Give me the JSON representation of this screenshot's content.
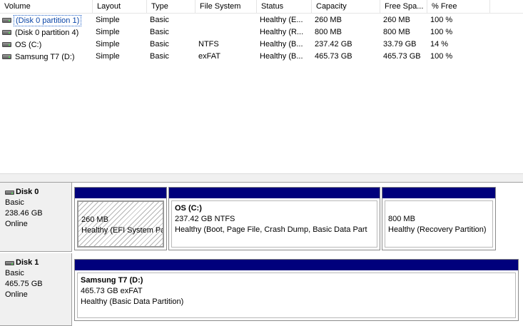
{
  "volume_list": {
    "columns": [
      "Volume",
      "Layout",
      "Type",
      "File System",
      "Status",
      "Capacity",
      "Free Spa...",
      "% Free"
    ],
    "rows": [
      {
        "volume": "(Disk 0 partition 1)",
        "layout": "Simple",
        "type": "Basic",
        "fs": "",
        "status": "Healthy (E...",
        "capacity": "260 MB",
        "free": "260 MB",
        "pct": "100 %",
        "selected": true
      },
      {
        "volume": "(Disk 0 partition 4)",
        "layout": "Simple",
        "type": "Basic",
        "fs": "",
        "status": "Healthy (R...",
        "capacity": "800 MB",
        "free": "800 MB",
        "pct": "100 %"
      },
      {
        "volume": "OS (C:)",
        "layout": "Simple",
        "type": "Basic",
        "fs": "NTFS",
        "status": "Healthy (B...",
        "capacity": "237.42 GB",
        "free": "33.79 GB",
        "pct": "14 %"
      },
      {
        "volume": "Samsung T7 (D:)",
        "layout": "Simple",
        "type": "Basic",
        "fs": "exFAT",
        "status": "Healthy (B...",
        "capacity": "465.73 GB",
        "free": "465.73 GB",
        "pct": "100 %"
      }
    ]
  },
  "disks": [
    {
      "name": "Disk 0",
      "type": "Basic",
      "size": "238.46 GB",
      "state": "Online",
      "partitions": [
        {
          "title": "",
          "size": "260 MB",
          "status": "Healthy (EFI System Pa"
        },
        {
          "title": "OS  (C:)",
          "size": "237.42 GB NTFS",
          "status": "Healthy (Boot, Page File, Crash Dump, Basic Data Part"
        },
        {
          "title": "",
          "size": "800 MB",
          "status": "Healthy (Recovery Partition)"
        }
      ]
    },
    {
      "name": "Disk 1",
      "type": "Basic",
      "size": "465.75 GB",
      "state": "Online",
      "partitions": [
        {
          "title": "Samsung T7  (D:)",
          "size": "465.73 GB exFAT",
          "status": "Healthy (Basic Data Partition)"
        }
      ]
    }
  ],
  "colors": {
    "partition_bar": "#00007c",
    "disk_info_bg": "#f0f0f0",
    "selection": "#1e60c8"
  },
  "icons": {
    "volume": "drive-icon",
    "disk": "disk-icon"
  }
}
